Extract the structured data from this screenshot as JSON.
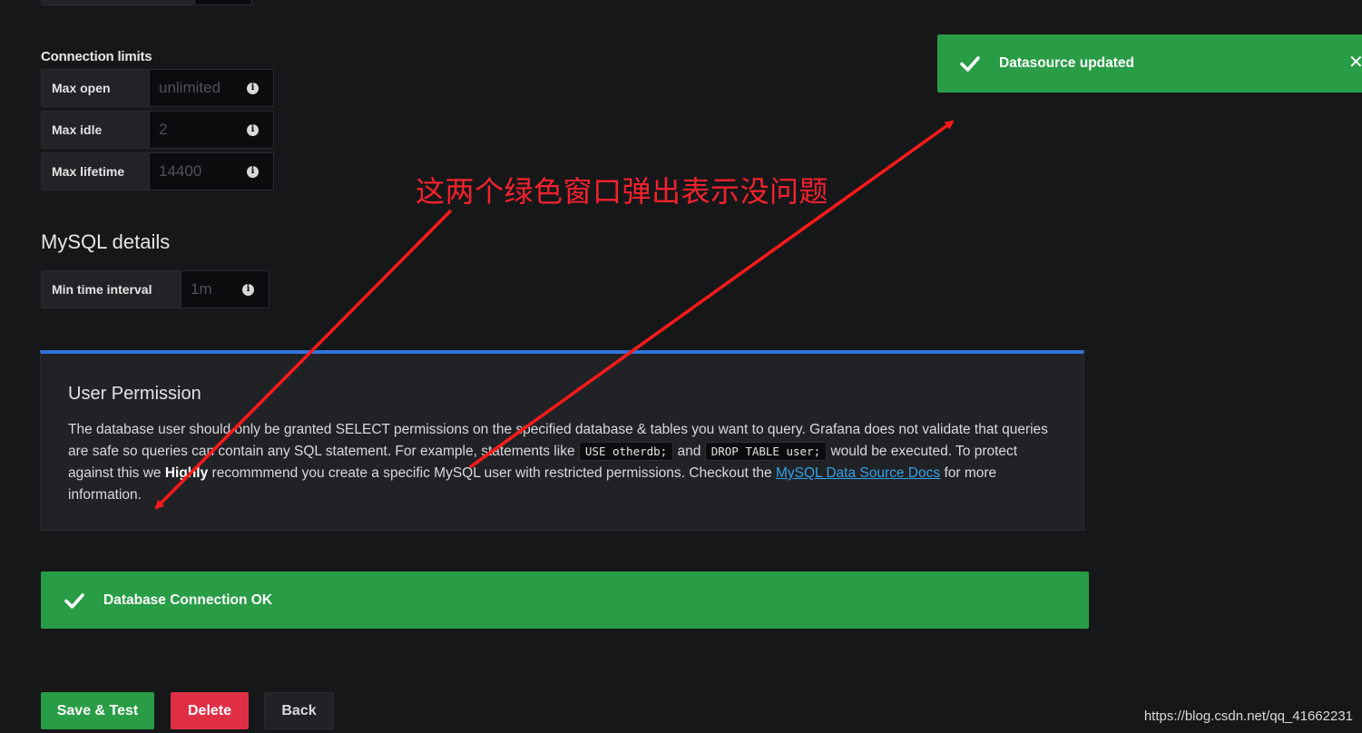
{
  "connection_limits": {
    "title": "Connection limits",
    "fields": [
      {
        "label": "Max open",
        "placeholder": "unlimited"
      },
      {
        "label": "Max idle",
        "placeholder": "2"
      },
      {
        "label": "Max lifetime",
        "placeholder": "14400"
      }
    ]
  },
  "mysql_details": {
    "title": "MySQL details",
    "min_interval_label": "Min time interval",
    "min_interval_placeholder": "1m"
  },
  "permission": {
    "title": "User Permission",
    "text_1": "The database user should only be granted SELECT permissions on the specified database & tables you want to query. Grafana does not validate that queries are safe so queries can contain any SQL statement. For example, statements like",
    "code_1": "USE otherdb;",
    "text_and": "and",
    "code_2": "DROP TABLE user;",
    "text_2": "would be executed. To protect against this we",
    "highly": "Highly",
    "text_3": "recommmend you create a specific MySQL user with restricted permissions. Checkout the",
    "link": "MySQL Data Source Docs",
    "text_4": "for more information."
  },
  "alerts": {
    "db_ok": "Database Connection OK",
    "toast": "Datasource updated",
    "toast_close": "✕"
  },
  "buttons": {
    "save": "Save & Test",
    "delete": "Delete",
    "back": "Back"
  },
  "annotation": "这两个绿色窗口弹出表示没问题",
  "watermark": "https://blog.csdn.net/qq_41662231",
  "colors": {
    "background": "#161719",
    "success": "#299c46",
    "danger": "#e02f44",
    "accent_border": "#3274d9",
    "link": "#33a2e5",
    "annotation_red": "#f5222d"
  }
}
